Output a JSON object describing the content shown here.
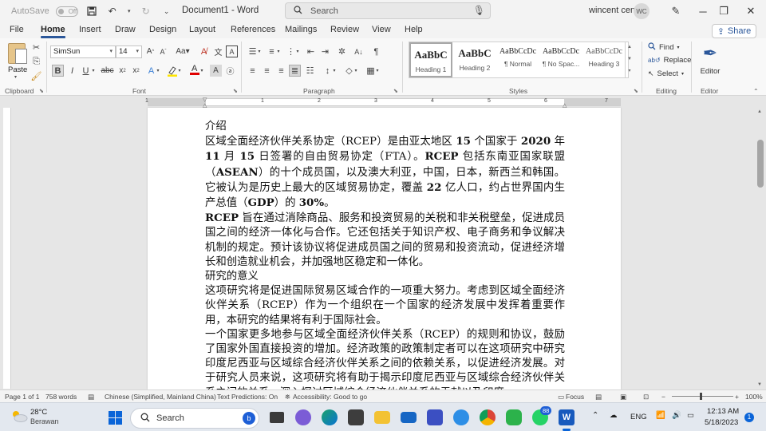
{
  "titlebar": {
    "autosave_label": "AutoSave",
    "autosave_state": "Off",
    "doc_title": "Document1 - Word",
    "search_placeholder": "Search",
    "user_name": "wincent cent",
    "user_initials": "WC"
  },
  "menu": {
    "tabs": [
      "File",
      "Home",
      "Insert",
      "Draw",
      "Design",
      "Layout",
      "References",
      "Mailings",
      "Review",
      "View",
      "Help"
    ],
    "active_tab": "Home",
    "share_label": "Share"
  },
  "ribbon": {
    "clipboard": {
      "paste_label": "Paste",
      "group_label": "Clipboard"
    },
    "font": {
      "font_name": "SimSun",
      "font_size": "14",
      "group_label": "Font"
    },
    "paragraph": {
      "group_label": "Paragraph"
    },
    "styles": {
      "group_label": "Styles",
      "items": [
        {
          "sample": "AaBbC",
          "name": "Heading 1"
        },
        {
          "sample": "AaBbC",
          "name": "Heading 2"
        },
        {
          "sample": "AaBbCcDc",
          "name": "¶ Normal"
        },
        {
          "sample": "AaBbCcDc",
          "name": "¶ No Spac..."
        },
        {
          "sample": "AaBbCcDc",
          "name": "Heading 3"
        }
      ]
    },
    "editing": {
      "group_label": "Editing",
      "find_label": "Find",
      "replace_label": "Replace",
      "select_label": "Select"
    },
    "editor": {
      "label": "Editor",
      "group_label": "Editor"
    }
  },
  "ruler_numbers": [
    "1",
    "1",
    "2",
    "3",
    "4",
    "5",
    "6",
    "7"
  ],
  "document": {
    "h1": "介绍",
    "p1": [
      {
        "t": "区域全面经济伙伴关系协定（RCEP）是由亚太地区 ",
        "b": false
      },
      {
        "t": "15",
        "b": true
      },
      {
        "t": " 个国家于 ",
        "b": false
      },
      {
        "t": "2020",
        "b": true
      },
      {
        "t": " 年 ",
        "b": false
      },
      {
        "t": "11",
        "b": true
      },
      {
        "t": " 月 ",
        "b": false
      },
      {
        "t": "15",
        "b": true
      },
      {
        "t": " 日签署的自由贸易协定（FTA）。",
        "b": false
      },
      {
        "t": "RCEP",
        "b": true
      },
      {
        "t": " 包括东南亚国家联盟（",
        "b": false
      },
      {
        "t": "ASEAN",
        "b": true
      },
      {
        "t": "）的十个成员国，以及澳大利亚，中国，日本，新西兰和韩国。它被认为是历史上最大的区域贸易协定，覆盖 ",
        "b": false
      },
      {
        "t": "22",
        "b": true
      },
      {
        "t": " 亿人口，约占世界国内生产总值（",
        "b": false
      },
      {
        "t": "GDP",
        "b": true
      },
      {
        "t": "）的 ",
        "b": false
      },
      {
        "t": "30%",
        "b": true
      },
      {
        "t": "。",
        "b": false
      }
    ],
    "p2": [
      {
        "t": "RCEP",
        "b": true
      },
      {
        "t": " 旨在通过消除商品、服务和投资贸易的关税和非关税壁垒，促进成员国之间的经济一体化与合作。它还包括关于知识产权、电子商务和争议解决机制的规定。预计该协议将促进成员国之间的贸易和投资流动，促进经济增长和创造就业机会，并加强地区稳定和一体化。",
        "b": false
      }
    ],
    "h2": "研究的意义",
    "p3": "这项研究将是促进国际贸易区域合作的一项重大努力。考虑到区域全面经济伙伴关系（RCEP）作为一个组织在一个国家的经济发展中发挥着重要作用，本研究的结果将有利于国际社会。",
    "p4": "一个国家更多地参与区域全面经济伙伴关系（RCEP）的规则和协议，鼓励了国家外国直接投资的增加。经济政策的政策制定者可以在这项研究中研究印度尼西亚与区域综合经济伙伴关系之间的依赖关系，以促进经济发展。对于研究人员来说，这项研究将有助于揭示印度尼西亚与区域综合经济伙伴关系之间的关系，深入探讨区域综合经济伙伴关系的贡献以及印度"
  },
  "status": {
    "page": "Page 1 of 1",
    "words": "758 words",
    "language": "Chinese (Simplified, Mainland China)",
    "predictions": "Text Predictions: On",
    "accessibility": "Accessibility: Good to go",
    "focus": "Focus",
    "zoom": "100%"
  },
  "taskbar": {
    "temp": "28°C",
    "weather": "Berawan",
    "search_label": "Search",
    "badge": "88",
    "lang": "ENG",
    "time": "12:13 AM",
    "date": "5/18/2023",
    "notifications": "1"
  },
  "colors": {
    "accent": "#2b579a",
    "word_blue": "#185abd",
    "start_blue": "#0a64d8"
  }
}
